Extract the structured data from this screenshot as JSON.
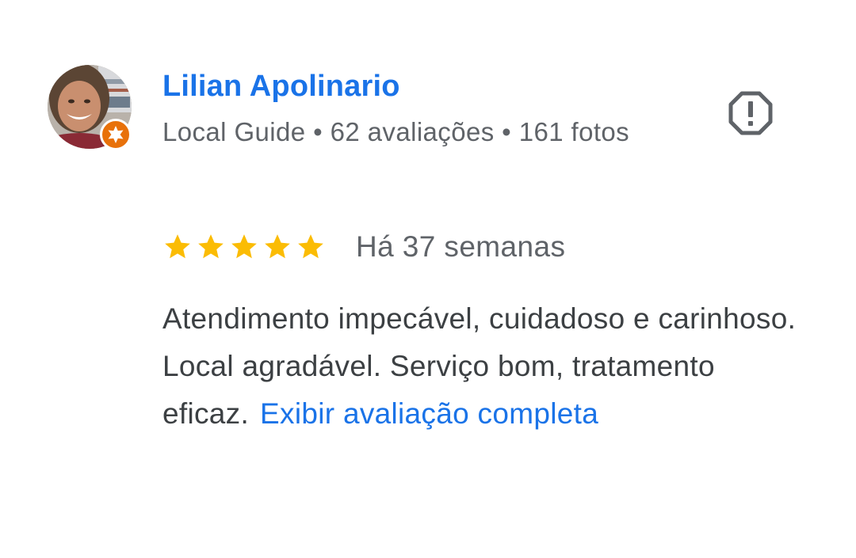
{
  "reviewer": {
    "name": "Lilian Apolinario",
    "meta": "Local Guide • 62 avaliações • 161 fotos",
    "avatar_icon": "user-avatar-photo",
    "badge_icon": "local-guide-star-icon",
    "badge_color": "#e8710a"
  },
  "actions": {
    "flag_icon": "report-flag-icon"
  },
  "review": {
    "rating": 5,
    "max_rating": 5,
    "date": "Há 37 semanas",
    "text": "Atendimento impecável, cuidadoso e carinhoso. Local agradável. Serviço bom, tratamento eficaz.",
    "more_label": "Exibir avaliação completa"
  },
  "colors": {
    "link": "#1a73e8",
    "meta": "#5f6368",
    "body": "#3c4043",
    "star": "#fbbc04",
    "icon": "#5f6368"
  }
}
